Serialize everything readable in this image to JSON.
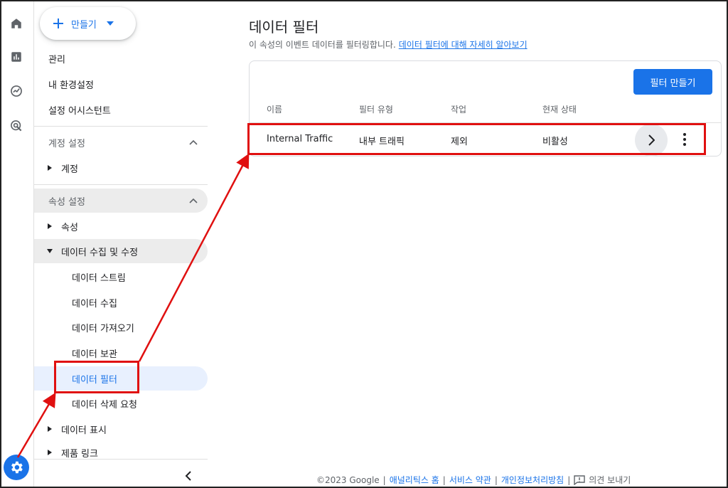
{
  "sidebar": {
    "create_label": "만들기",
    "top_items": [
      "관리",
      "내 환경설정",
      "설정 어시스턴트"
    ],
    "account_section": "계정 설정",
    "account_item": "계정",
    "property_section": "속성 설정",
    "property_item": "속성",
    "data_collection": "데이터 수집 및 수정",
    "sub_items": [
      "데이터 스트림",
      "데이터 수집",
      "데이터 가져오기",
      "데이터 보관",
      "데이터 필터",
      "데이터 삭제 요청"
    ],
    "data_display": "데이터 표시",
    "product_links": "제품 링크"
  },
  "main": {
    "title": "데이터 필터",
    "subtitle": "이 속성의 이벤트 데이터를 필터링합니다.",
    "learn_more": "데이터 필터에 대해 자세히 알아보기",
    "create_filter": "필터 만들기",
    "columns": [
      "이름",
      "필터 유형",
      "작업",
      "현재 상태"
    ],
    "row": {
      "name": "Internal Traffic",
      "type": "내부 트래픽",
      "action": "제외",
      "status": "비활성"
    }
  },
  "footer": {
    "copyright": "©2023 Google",
    "links": [
      "애널리틱스 홈",
      "서비스 약관",
      "개인정보처리방침"
    ],
    "feedback": "의견 보내기"
  },
  "colors": {
    "accent": "#1a73e8",
    "annotation": "#e01010",
    "selected_bg": "#e8f0fe"
  }
}
